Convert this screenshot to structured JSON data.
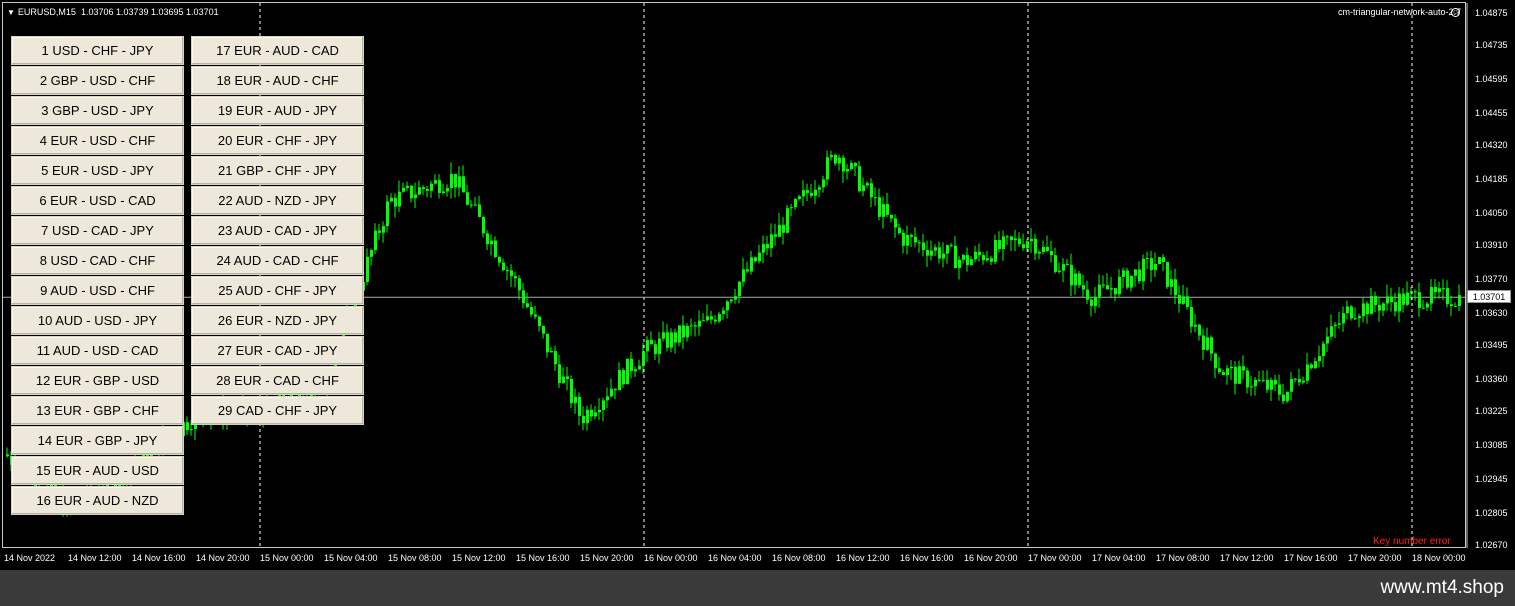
{
  "symbol_header": {
    "symbol": "EURUSD,M15",
    "ohlc": "1.03706 1.03739 1.03695 1.03701"
  },
  "ea_label": "cm-triangular-network-auto-2.7",
  "key_error": "Key number error",
  "watermark": "www.mt4.shop",
  "current_price": "1.03701",
  "colors": {
    "candle": "#00ff00",
    "background": "#000000",
    "button_face": "#ede8d9",
    "error_text": "#ff2020",
    "bottom_bar": "#3a3a3a"
  },
  "network_buttons": [
    {
      "num": "1",
      "pair": "USD - CHF - JPY"
    },
    {
      "num": "2",
      "pair": "GBP - USD - CHF"
    },
    {
      "num": "3",
      "pair": "GBP - USD - JPY"
    },
    {
      "num": "4",
      "pair": "EUR - USD - CHF"
    },
    {
      "num": "5",
      "pair": "EUR - USD - JPY"
    },
    {
      "num": "6",
      "pair": "EUR - USD - CAD"
    },
    {
      "num": "7",
      "pair": "USD - CAD - JPY"
    },
    {
      "num": "8",
      "pair": "USD - CAD - CHF"
    },
    {
      "num": "9",
      "pair": "AUD - USD - CHF"
    },
    {
      "num": "10",
      "pair": "AUD - USD - JPY"
    },
    {
      "num": "11",
      "pair": "AUD - USD - CAD"
    },
    {
      "num": "12",
      "pair": "EUR - GBP - USD"
    },
    {
      "num": "13",
      "pair": "EUR - GBP - CHF"
    },
    {
      "num": "14",
      "pair": "EUR - GBP - JPY"
    },
    {
      "num": "15",
      "pair": "EUR - AUD - USD"
    },
    {
      "num": "16",
      "pair": "EUR - AUD - NZD"
    },
    {
      "num": "17",
      "pair": "EUR - AUD - CAD"
    },
    {
      "num": "18",
      "pair": "EUR - AUD - CHF"
    },
    {
      "num": "19",
      "pair": "EUR - AUD - JPY"
    },
    {
      "num": "20",
      "pair": "EUR - CHF - JPY"
    },
    {
      "num": "21",
      "pair": "GBP - CHF - JPY"
    },
    {
      "num": "22",
      "pair": "AUD - NZD - JPY"
    },
    {
      "num": "23",
      "pair": "AUD - CAD - JPY"
    },
    {
      "num": "24",
      "pair": "AUD - CAD - CHF"
    },
    {
      "num": "25",
      "pair": "AUD - CHF - JPY"
    },
    {
      "num": "26",
      "pair": "EUR - NZD - JPY"
    },
    {
      "num": "27",
      "pair": "EUR - CAD - JPY"
    },
    {
      "num": "28",
      "pair": "EUR - CAD - CHF"
    },
    {
      "num": "29",
      "pair": "CAD - CHF - JPY"
    }
  ],
  "price_axis": [
    "1.04875",
    "1.04735",
    "1.04595",
    "1.04455",
    "1.04320",
    "1.04185",
    "1.04050",
    "1.03910",
    "1.03770",
    "1.03630",
    "1.03495",
    "1.03360",
    "1.03225",
    "1.03085",
    "1.02945",
    "1.02805",
    "1.02670"
  ],
  "time_axis": [
    "14 Nov 2022",
    "14 Nov 12:00",
    "14 Nov 16:00",
    "14 Nov 20:00",
    "15 Nov 00:00",
    "15 Nov 04:00",
    "15 Nov 08:00",
    "15 Nov 12:00",
    "15 Nov 16:00",
    "15 Nov 20:00",
    "16 Nov 00:00",
    "16 Nov 04:00",
    "16 Nov 08:00",
    "16 Nov 12:00",
    "16 Nov 16:00",
    "16 Nov 20:00",
    "17 Nov 00:00",
    "17 Nov 04:00",
    "17 Nov 08:00",
    "17 Nov 12:00",
    "17 Nov 16:00",
    "17 Nov 20:00",
    "18 Nov 00:00"
  ],
  "price_path": [
    [
      "14 Nov 2022",
      1.0305
    ],
    [
      "14 Nov 12:00",
      1.0282
    ],
    [
      "14 Nov 16:00",
      1.03
    ],
    [
      "14 Nov 20:00",
      1.0322
    ],
    [
      "15 Nov 00:00",
      1.0322
    ],
    [
      "15 Nov 04:00",
      1.0335
    ],
    [
      "15 Nov 08:00",
      1.041
    ],
    [
      "15 Nov 12:00",
      1.042
    ],
    [
      "15 Nov 16:00",
      1.0375
    ],
    [
      "15 Nov 20:00",
      1.032
    ],
    [
      "16 Nov 00:00",
      1.0348
    ],
    [
      "16 Nov 04:00",
      1.036
    ],
    [
      "16 Nov 08:00",
      1.0395
    ],
    [
      "16 Nov 12:00",
      1.043
    ],
    [
      "16 Nov 16:00",
      1.0395
    ],
    [
      "16 Nov 20:00",
      1.0385
    ],
    [
      "17 Nov 00:00",
      1.0395
    ],
    [
      "17 Nov 04:00",
      1.037
    ],
    [
      "17 Nov 08:00",
      1.0385
    ],
    [
      "17 Nov 12:00",
      1.034
    ],
    [
      "17 Nov 16:00",
      1.033
    ],
    [
      "17 Nov 20:00",
      1.0365
    ],
    [
      "18 Nov 00:00",
      1.037
    ]
  ]
}
